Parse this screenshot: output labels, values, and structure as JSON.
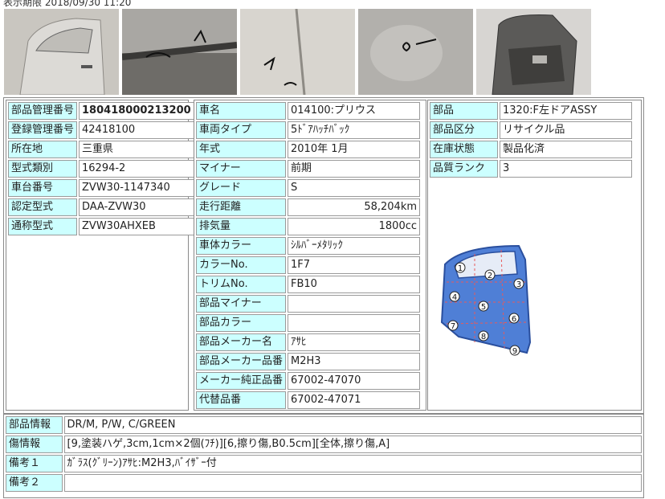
{
  "header": {
    "datetime_text": "表示期限 2018/09/30 11:20"
  },
  "photos": [
    {
      "alt": "door-outer-photo"
    },
    {
      "alt": "door-mark-photo"
    },
    {
      "alt": "door-closeup-photo"
    },
    {
      "alt": "door-scratch-photo"
    },
    {
      "alt": "door-inner-photo"
    }
  ],
  "left_table": [
    {
      "label": "部品管理番号",
      "value": "180418000213200"
    },
    {
      "label": "登録管理番号",
      "value": "42418100"
    },
    {
      "label": "所在地",
      "value": "三重県"
    },
    {
      "label": "型式類別",
      "value": "16294-2"
    },
    {
      "label": "車台番号",
      "value": "ZVW30-1147340"
    },
    {
      "label": "認定型式",
      "value": "DAA-ZVW30"
    },
    {
      "label": "通称型式",
      "value": "ZVW30AHXEB"
    }
  ],
  "middle_table": [
    {
      "label": "車名",
      "value": "014100:プリウス"
    },
    {
      "label": "車両タイプ",
      "value": "5ﾄﾞｱﾊｯﾁﾊﾞｯｸ"
    },
    {
      "label": "年式",
      "value": "2010年 1月"
    },
    {
      "label": "マイナー",
      "value": "前期"
    },
    {
      "label": "グレード",
      "value": "S"
    },
    {
      "label": "走行距離",
      "value": "58,204km"
    },
    {
      "label": "排気量",
      "value": "1800cc"
    },
    {
      "label": "車体カラー",
      "value": "ｼﾙﾊﾞｰﾒﾀﾘｯｸ"
    },
    {
      "label": "カラーNo.",
      "value": "1F7"
    },
    {
      "label": "トリムNo.",
      "value": "FB10"
    },
    {
      "label": "部品マイナー",
      "value": ""
    },
    {
      "label": "部品カラー",
      "value": ""
    },
    {
      "label": "部品メーカー名",
      "value": "ｱｻﾋ"
    },
    {
      "label": "部品メーカー品番",
      "value": "M2H3"
    },
    {
      "label": "メーカー純正品番",
      "value": "67002-47070"
    },
    {
      "label": "代替品番",
      "value": "67002-47071"
    }
  ],
  "right_table": [
    {
      "label": "部品",
      "value": "1320:F左ドアASSY"
    },
    {
      "label": "部品区分",
      "value": "リサイクル品"
    },
    {
      "label": "在庫状態",
      "value": "製品化済"
    },
    {
      "label": "品質ランク",
      "value": "3"
    }
  ],
  "diagram": {
    "zones": [
      "1",
      "2",
      "3",
      "4",
      "5",
      "6",
      "7",
      "8",
      "9"
    ],
    "colors": {
      "door": "#4f7fd6",
      "zone_line": "#e85a5a"
    }
  },
  "bottom_table": [
    {
      "label": "部品情報",
      "value": "DR/M, P/W, C/GREEN"
    },
    {
      "label": "傷情報",
      "value": "[9,塗装ハゲ,3cm,1cm×2個(ﾌﾁ)][6,擦り傷,B0.5cm][全体,擦り傷,A]"
    },
    {
      "label": "備考１",
      "value": "ｶﾞﾗｽ(ｸﾞﾘｰﾝ)ｱｻﾋ:M2H3,ﾊﾞｲｻﾞｰ付"
    },
    {
      "label": "備考２",
      "value": ""
    }
  ],
  "colors": {
    "label_bg": "#ccffff",
    "border": "#9a9a9a"
  }
}
